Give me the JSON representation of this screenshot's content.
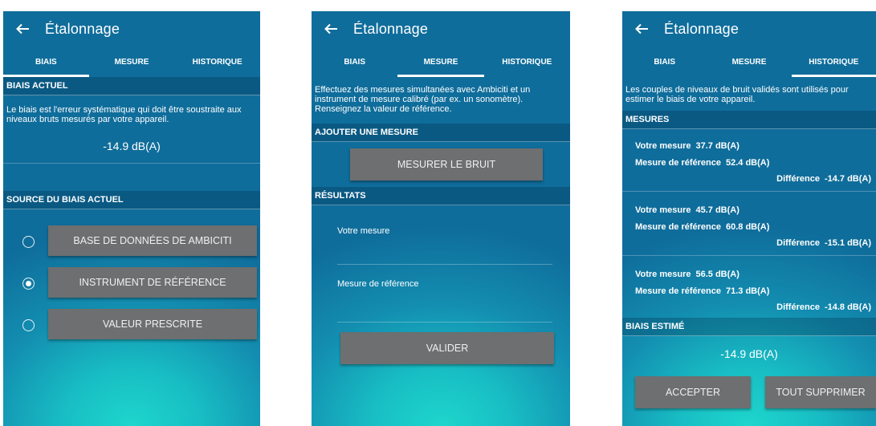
{
  "screens": [
    {
      "title": "Étalonnage",
      "tabs": [
        {
          "label": "BIAIS"
        },
        {
          "label": "MESURE"
        },
        {
          "label": "HISTORIQUE"
        }
      ],
      "active_tab": 0,
      "section_current": "BIAIS ACTUEL",
      "description": "Le biais est l'erreur systématique qui doit être soustraite aux niveaux bruts mesurés par votre appareil.",
      "current_value": "-14.9 dB(A)",
      "section_source": "SOURCE DU BIAIS ACTUEL",
      "sources": [
        {
          "label": "BASE DE DONNÉES DE AMBICITI",
          "selected": false
        },
        {
          "label": "INSTRUMENT DE RÉFÉRENCE",
          "selected": true
        },
        {
          "label": "VALEUR PRESCRITE",
          "selected": false
        }
      ]
    },
    {
      "title": "Étalonnage",
      "tabs": [
        {
          "label": "BIAIS"
        },
        {
          "label": "MESURE"
        },
        {
          "label": "HISTORIQUE"
        }
      ],
      "active_tab": 1,
      "intro": "Effectuez des mesures simultanées avec Ambiciti et un instrument de mesure calibré (par ex. un sonomètre). Renseignez la valeur de référence.",
      "section_add": "AJOUTER UNE MESURE",
      "measure_button": "MESURER LE BRUIT",
      "section_results": "RÉSULTATS",
      "your_measure_label": "Votre mesure",
      "your_measure_value": "",
      "reference_label": "Mesure de référence",
      "reference_value": "",
      "validate_button": "VALIDER"
    },
    {
      "title": "Étalonnage",
      "tabs": [
        {
          "label": "BIAIS"
        },
        {
          "label": "MESURE"
        },
        {
          "label": "HISTORIQUE"
        }
      ],
      "active_tab": 2,
      "intro": "Les couples de niveaux de bruit validés sont utilisés pour estimer le biais de votre appareil.",
      "section_measures": "MESURES",
      "measures": [
        {
          "your_label": "Votre mesure",
          "your_value": "37.7 dB(A)",
          "ref_label": "Mesure de référence",
          "ref_value": "52.4 dB(A)",
          "diff_label": "Différence",
          "diff_value": "-14.7 dB(A)"
        },
        {
          "your_label": "Votre mesure",
          "your_value": "45.7 dB(A)",
          "ref_label": "Mesure de référence",
          "ref_value": "60.8 dB(A)",
          "diff_label": "Différence",
          "diff_value": "-15.1 dB(A)"
        },
        {
          "your_label": "Votre mesure",
          "your_value": "56.5 dB(A)",
          "ref_label": "Mesure de référence",
          "ref_value": "71.3 dB(A)",
          "diff_label": "Différence",
          "diff_value": "-14.8 dB(A)"
        }
      ],
      "section_estimated": "BIAIS ESTIMÉ",
      "estimated_value": "-14.9 dB(A)",
      "accept_button": "ACCEPTER",
      "delete_all_button": "TOUT SUPPRIMER"
    }
  ]
}
